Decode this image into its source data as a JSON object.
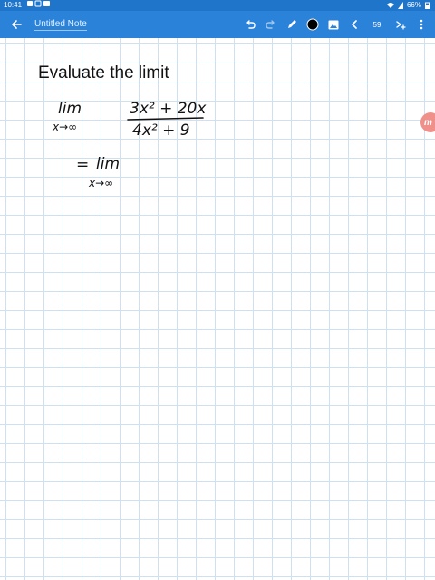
{
  "status_bar": {
    "time": "10:41",
    "battery": "66%"
  },
  "app_bar": {
    "title": "Untitled Note",
    "page_number": "59",
    "icons": [
      "back-arrow-icon",
      "undo-icon",
      "redo-icon",
      "pen-icon",
      "color-swatch-icon",
      "image-icon",
      "chevron-left-icon",
      "add-page-icon",
      "more-vert-icon"
    ],
    "color_swatch": "#000000"
  },
  "note": {
    "heading": "Evaluate the limit",
    "line1": {
      "lim": "lim",
      "approach": "x→∞",
      "numerator": "3x² + 20x",
      "denominator": "4x² + 9"
    },
    "line2": {
      "equals": "=",
      "lim": "lim",
      "approach": "x→∞"
    }
  },
  "side_button": {
    "label": "m"
  },
  "colors": {
    "status_bar": "#1f75c9",
    "app_bar": "#2b82d9",
    "grid": "#cfe0ef",
    "side_button": "#f0908a"
  }
}
